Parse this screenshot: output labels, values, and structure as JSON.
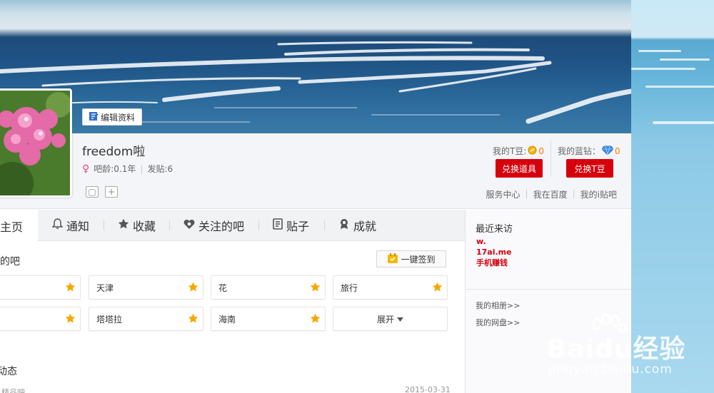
{
  "profile": {
    "username": "freedom啦",
    "gender_symbol": "♀",
    "age_label": "吧龄:0.1年",
    "posts_label": "发贴:6",
    "edit_label": "编辑资料"
  },
  "wallet": {
    "tdou_label": "我的T豆:",
    "tdou_value": "0",
    "diamond_label": "我的蓝钻：",
    "diamond_value": "0",
    "exchange_items": "兑换道具",
    "exchange_tdou": "兑换T豆"
  },
  "links": {
    "service": "服务中心",
    "baidu": "我在百度",
    "itieba": "我的i贴吧"
  },
  "tabs": [
    {
      "label": "主页",
      "icon": "home-icon"
    },
    {
      "label": "通知",
      "icon": "bell-icon"
    },
    {
      "label": "收藏",
      "icon": "star-icon"
    },
    {
      "label": "关注的吧",
      "icon": "heart-icon"
    },
    {
      "label": "贴子",
      "icon": "document-icon"
    },
    {
      "label": "成就",
      "icon": "badge-icon"
    }
  ],
  "bars_section": {
    "title": "的吧",
    "sign_label": "一键签到",
    "bars": [
      "",
      "天津",
      "花",
      "旅行",
      "",
      "塔塔拉",
      "海南"
    ],
    "expand_label": "展开"
  },
  "feed": {
    "title": "动态",
    "date": "2015-03-31",
    "fragment": "精品吧"
  },
  "sidebar": {
    "visitors_title": "最近来访",
    "ad_lines": [
      "w.",
      "17ai.me",
      "手机赚钱"
    ],
    "album_link": "我的相册>>",
    "disk_link": "我的网盘>>"
  },
  "watermark": {
    "big": "Baidu经验",
    "small": "jingyan.baidu.com"
  },
  "colors": {
    "accent_red": "#d6000d",
    "coin_orange": "#ff7a00"
  }
}
